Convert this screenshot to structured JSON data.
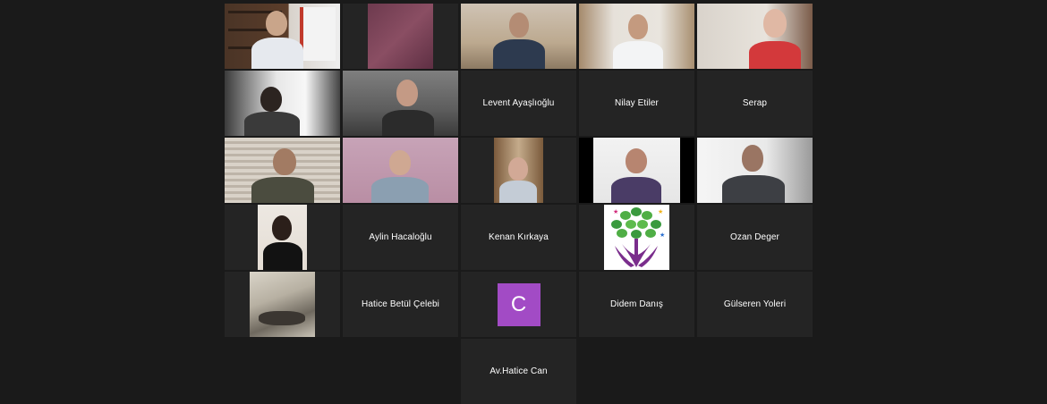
{
  "meeting": {
    "participants": [
      {
        "id": "p1",
        "kind": "video",
        "active": true,
        "scene": "speaker-hdp-flag"
      },
      {
        "id": "p2",
        "kind": "video",
        "scene": "pink-texture"
      },
      {
        "id": "p3",
        "kind": "video",
        "scene": "man-home"
      },
      {
        "id": "p4",
        "kind": "video",
        "scene": "man-glasses-bookshelf"
      },
      {
        "id": "p5",
        "kind": "video",
        "scene": "older-man-red-shirt"
      },
      {
        "id": "p6",
        "kind": "video",
        "scene": "person-window"
      },
      {
        "id": "p7",
        "kind": "video",
        "scene": "woman-glasses-room"
      },
      {
        "id": "p8",
        "kind": "name",
        "name": "Levent Ayaşlıoğlu"
      },
      {
        "id": "p9",
        "kind": "name",
        "name": "Nilay Etiler"
      },
      {
        "id": "p10",
        "kind": "name",
        "name": "Serap"
      },
      {
        "id": "p11",
        "kind": "video",
        "scene": "man-glasses-blinds"
      },
      {
        "id": "p12",
        "kind": "video",
        "scene": "woman-headscarf"
      },
      {
        "id": "p13",
        "kind": "video",
        "scene": "older-woman-bookshelf"
      },
      {
        "id": "p14",
        "kind": "video",
        "scene": "woman-white-wall"
      },
      {
        "id": "p15",
        "kind": "video",
        "scene": "man-light-room"
      },
      {
        "id": "p16",
        "kind": "video",
        "scene": "woman-dark-hair"
      },
      {
        "id": "p17",
        "kind": "name",
        "name": "Aylin Hacaloğlu"
      },
      {
        "id": "p18",
        "kind": "name",
        "name": "Kenan Kırkaya"
      },
      {
        "id": "p19",
        "kind": "logo",
        "scene": "hdp-tree-logo"
      },
      {
        "id": "p20",
        "kind": "name",
        "name": "Ozan Deger"
      },
      {
        "id": "p21",
        "kind": "picture",
        "scene": "etching-artwork"
      },
      {
        "id": "p22",
        "kind": "name",
        "name": "Hatice Betül Çelebi"
      },
      {
        "id": "p23",
        "kind": "avatar",
        "initial": "C",
        "color": "#a24bc5"
      },
      {
        "id": "p24",
        "kind": "name",
        "name": "Didem Danış"
      },
      {
        "id": "p25",
        "kind": "name",
        "name": "Gülseren Yoleri"
      },
      {
        "id": "p26",
        "kind": "empty"
      },
      {
        "id": "p27",
        "kind": "empty"
      },
      {
        "id": "p28",
        "kind": "name",
        "name": "Av.Hatice Can"
      }
    ]
  },
  "colors": {
    "background": "#1a1a1a",
    "tile": "#242424",
    "active_border": "#d9e23a",
    "name_text": "#ffffff",
    "avatar": "#a24bc5"
  }
}
